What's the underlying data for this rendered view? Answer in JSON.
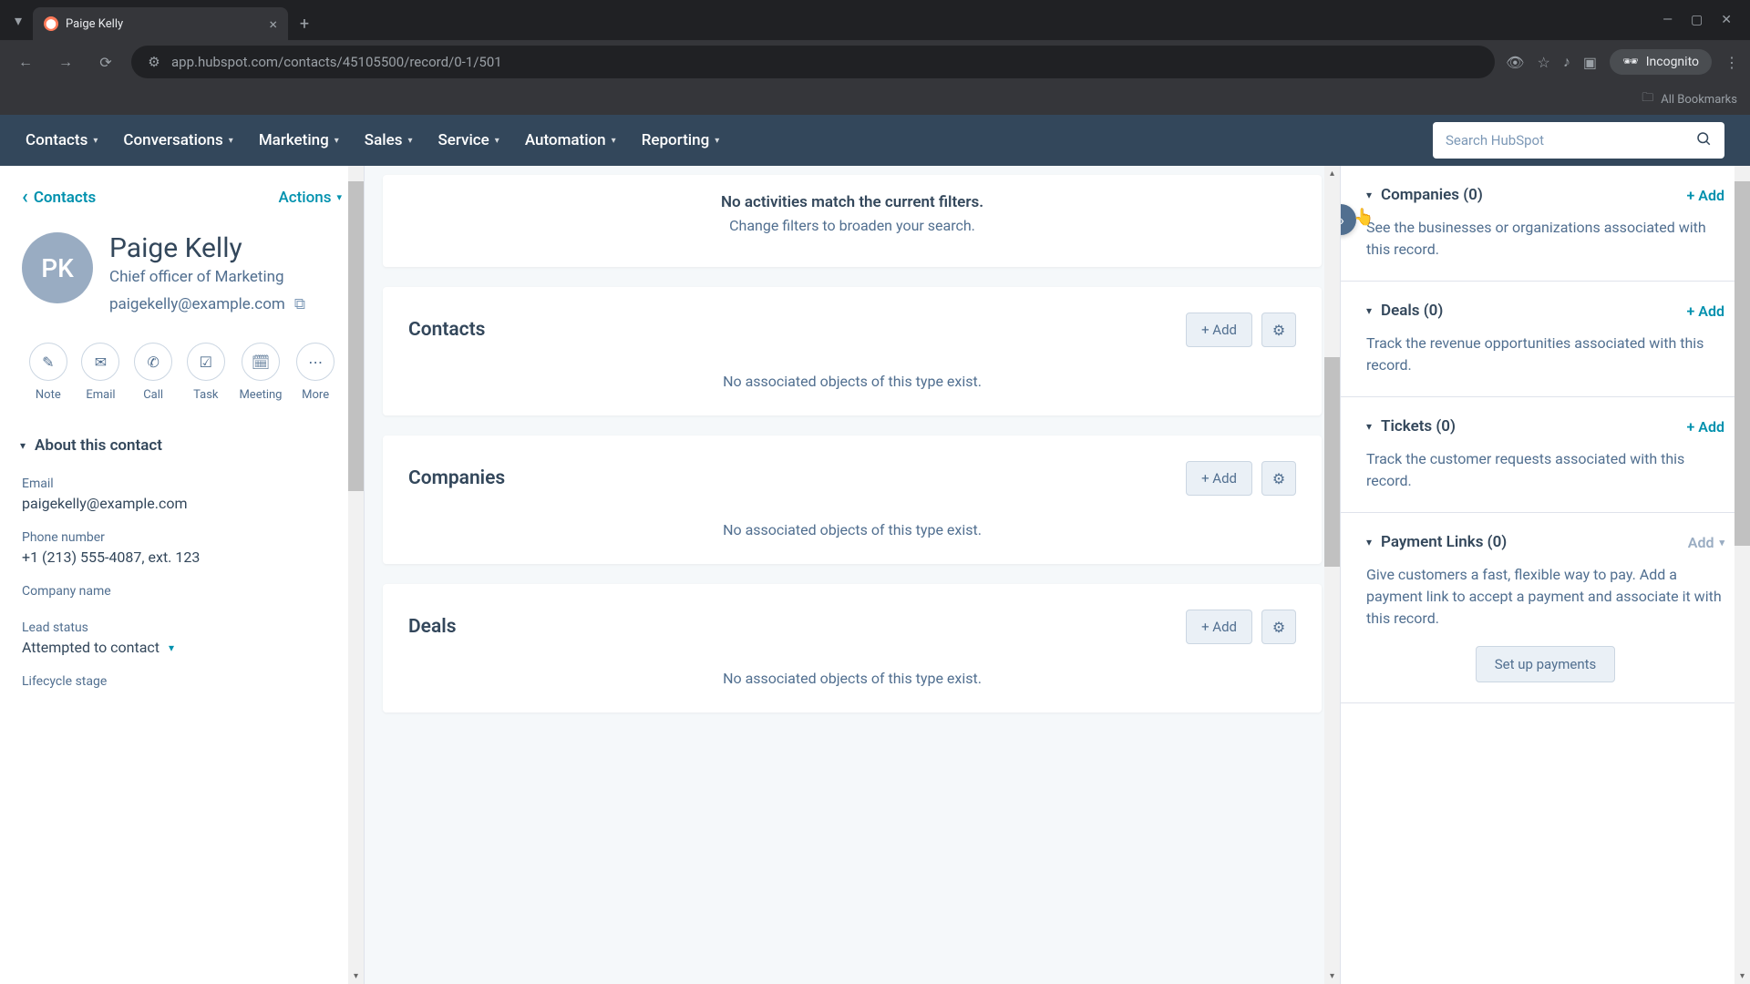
{
  "browser": {
    "tab_title": "Paige Kelly",
    "url": "app.hubspot.com/contacts/45105500/record/0-1/501",
    "incognito": "Incognito",
    "bookmarks": "All Bookmarks"
  },
  "nav": {
    "items": [
      "Contacts",
      "Conversations",
      "Marketing",
      "Sales",
      "Service",
      "Automation",
      "Reporting"
    ],
    "search_placeholder": "Search HubSpot"
  },
  "left": {
    "back": "Contacts",
    "actions": "Actions",
    "avatar_initials": "PK",
    "name": "Paige Kelly",
    "title": "Chief officer of Marketing",
    "email": "paigekelly@example.com",
    "actions_row": [
      "Note",
      "Email",
      "Call",
      "Task",
      "Meeting",
      "More"
    ],
    "about_header": "About this contact",
    "fields": {
      "email_label": "Email",
      "email_value": "paigekelly@example.com",
      "phone_label": "Phone number",
      "phone_value": "+1 (213) 555-4087, ext. 123",
      "company_label": "Company name",
      "lead_label": "Lead status",
      "lead_value": "Attempted to contact",
      "lifecycle_label": "Lifecycle stage"
    }
  },
  "center": {
    "empty_title": "No activities match the current filters.",
    "empty_sub": "Change filters to broaden your search.",
    "add_label": "Add",
    "no_assoc": "No associated objects of this type exist.",
    "cards": [
      "Contacts",
      "Companies",
      "Deals"
    ]
  },
  "right": {
    "add": "+ Add",
    "add_plain": "Add",
    "setup": "Set up payments",
    "sections": {
      "companies": {
        "title": "Companies (0)",
        "desc": "See the businesses or organizations associated with this record."
      },
      "deals": {
        "title": "Deals (0)",
        "desc": "Track the revenue opportunities associated with this record."
      },
      "tickets": {
        "title": "Tickets (0)",
        "desc": "Track the customer requests associated with this record."
      },
      "payments": {
        "title": "Payment Links (0)",
        "desc": "Give customers a fast, flexible way to pay. Add a payment link to accept a payment and associate it with this record."
      }
    }
  }
}
